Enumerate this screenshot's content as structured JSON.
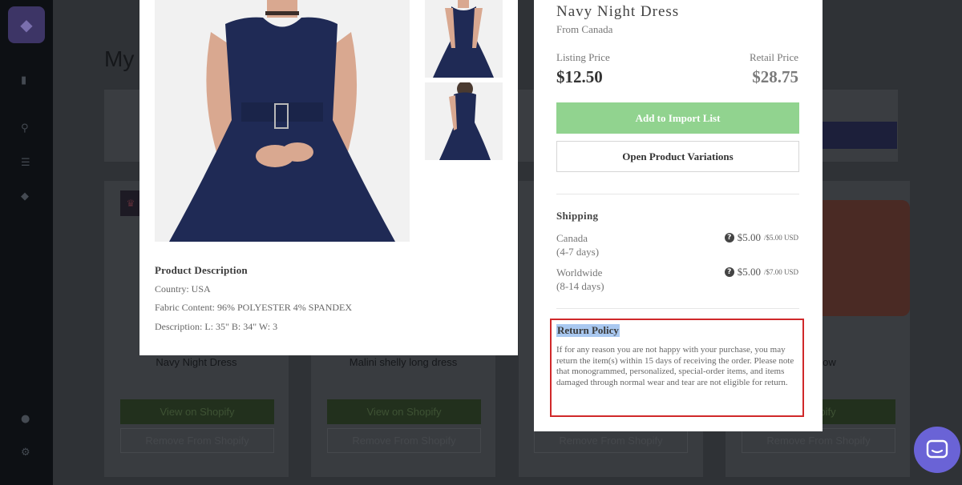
{
  "background": {
    "page_title": "My",
    "cards": [
      {
        "name": "Navy Night Dress",
        "view_label": "View on Shopify",
        "remove_label": "Remove From Shopify"
      },
      {
        "name": "Malini shelly long dress",
        "view_label": "View on Shopify",
        "remove_label": "Remove From Shopify"
      },
      {
        "name": "",
        "view_label": "",
        "remove_label": "Remove From Shopify"
      },
      {
        "name": "rt Pillow",
        "view_label": "Shopify",
        "remove_label": "Remove From Shopify"
      }
    ]
  },
  "product": {
    "name": "Navy Night Dress",
    "origin": "From Canada",
    "listing_price_label": "Listing Price",
    "listing_price": "$12.50",
    "retail_price_label": "Retail Price",
    "retail_price": "$28.75",
    "add_button": "Add to Import List",
    "variations_button": "Open Product Variations"
  },
  "description": {
    "title": "Product Description",
    "lines": [
      "Country: USA",
      "Fabric Content: 96% POLYESTER 4% SPANDEX",
      "Description: L: 35\" B: 34\" W: 3"
    ]
  },
  "shipping": {
    "title": "Shipping",
    "rows": [
      {
        "region": "Canada",
        "days": "(4-7 days)",
        "price": "$5.00",
        "usd": "/$5.00 USD"
      },
      {
        "region": "Worldwide",
        "days": "(8-14 days)",
        "price": "$5.00",
        "usd": "/$7.00 USD"
      }
    ]
  },
  "return_policy": {
    "title": "Return Policy",
    "text": "If for any reason you are not happy with your purchase, you may return the item(s) within 15 days of receiving the order. Please note that monogrammed, personalized, special-order items, and items damaged through normal wear and tear are not eligible for return."
  },
  "colors": {
    "add_button": "#91d38f",
    "highlight_box": "#d0282a",
    "chat": "#6a63d6",
    "dress": "#1f2a55"
  }
}
